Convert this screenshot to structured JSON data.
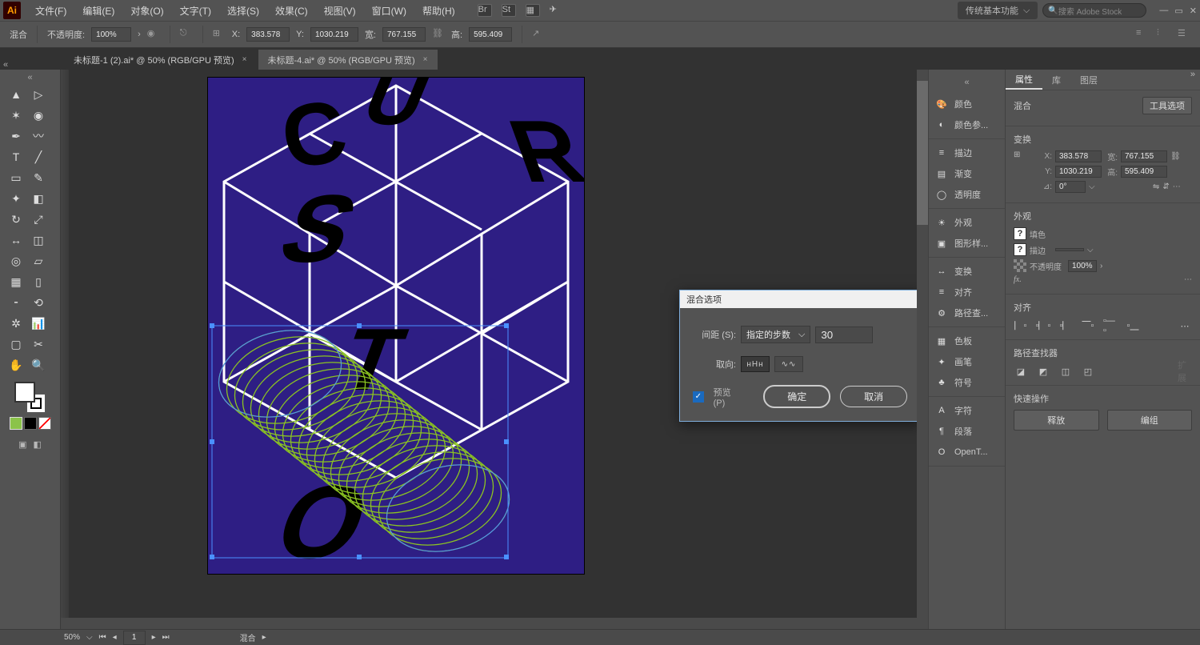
{
  "app": {
    "icon_text": "Ai"
  },
  "menus": [
    "文件(F)",
    "编辑(E)",
    "对象(O)",
    "文字(T)",
    "选择(S)",
    "效果(C)",
    "视图(V)",
    "窗口(W)",
    "帮助(H)"
  ],
  "workspace": {
    "label": "传统基本功能"
  },
  "search": {
    "placeholder": "搜索 Adobe Stock"
  },
  "control_bar": {
    "blend_label": "混合",
    "opacity_label": "不透明度:",
    "opacity_value": "100%",
    "x_label": "X:",
    "x": "383.578",
    "y_label": "Y:",
    "y": "1030.219",
    "w_label": "宽:",
    "w": "767.155",
    "h_label": "高:",
    "h": "595.409"
  },
  "tabs": [
    {
      "label": "未标题-1 (2).ai* @ 50% (RGB/GPU 预览)",
      "active": false
    },
    {
      "label": "未标题-4.ai* @ 50% (RGB/GPU 预览)",
      "active": true
    }
  ],
  "dialog": {
    "title": "混合选项",
    "spacing_label": "间距 (S):",
    "spacing_mode": "指定的步数",
    "spacing_value": "30",
    "orientation_label": "取向:",
    "preview_label": "预览 (P)",
    "ok": "确定",
    "cancel": "取消"
  },
  "right_icons": [
    [
      "颜色",
      "颜色参..."
    ],
    [
      "描边",
      "渐变",
      "透明度"
    ],
    [
      "外观",
      "图形样..."
    ],
    [
      "变换",
      "对齐",
      "路径查..."
    ],
    [
      "色板",
      "画笔",
      "符号"
    ],
    [
      "字符",
      "段落",
      "OpenT..."
    ]
  ],
  "right_glyphs": [
    [
      "🎨",
      "◐"
    ],
    [
      "≡",
      "▤",
      "◯"
    ],
    [
      "☀",
      "▣"
    ],
    [
      "↔",
      "≡",
      "⚙"
    ],
    [
      "▦",
      "✦",
      "♣"
    ],
    [
      "A",
      "¶",
      "O"
    ]
  ],
  "props": {
    "tabs": [
      "属性",
      "库",
      "图层"
    ],
    "selection": "混合",
    "tool_options": "工具选项",
    "transform": {
      "title": "变换",
      "x_label": "X:",
      "x": "383.578",
      "y_label": "Y:",
      "y": "1030.219",
      "w_label": "宽:",
      "w": "767.155",
      "h_label": "高:",
      "h": "595.409",
      "angle_label": "⊿:",
      "angle": "0°"
    },
    "appearance": {
      "title": "外观",
      "fill": "填色",
      "stroke": "描边",
      "opacity": "不透明度",
      "opacity_value": "100%"
    },
    "align": {
      "title": "对齐"
    },
    "pathfinder": {
      "title": "路径查找器"
    },
    "quick": {
      "title": "快速操作",
      "release": "释放",
      "edit": "编组"
    }
  },
  "status": {
    "zoom": "50%",
    "page": "1",
    "tool": "混合"
  }
}
